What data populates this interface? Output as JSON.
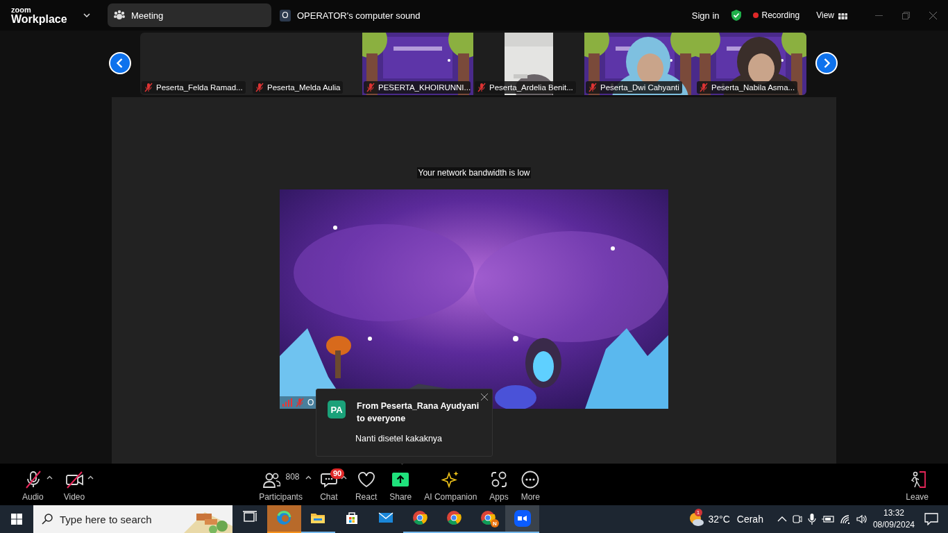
{
  "title_bar": {
    "logo_top": "zoom",
    "logo": "Workplace",
    "meeting_tab": {
      "label": "Meeting",
      "selected": true
    },
    "audio_source": {
      "badge": "O",
      "label": "OPERATOR's computer sound"
    },
    "sign_in": "Sign in",
    "recording": "Recording",
    "view": "View"
  },
  "gallery": {
    "tiles": [
      {
        "kind": "blank",
        "name": "Peserta_Felda Ramad...",
        "muted": true
      },
      {
        "kind": "blank",
        "name": "Peserta_Melda Aulia",
        "muted": true
      },
      {
        "kind": "picture",
        "name": "PESERTA_KHOIRUNNI...",
        "muted": true
      },
      {
        "kind": "picture",
        "name": "Peserta_Ardelia Benit...",
        "muted": true
      },
      {
        "kind": "picture",
        "name": "Peserta_Dwi Cahyanti",
        "muted": true
      },
      {
        "kind": "picture",
        "name": "Peserta_Nabila Asma...",
        "muted": true
      }
    ]
  },
  "stage": {
    "notice": "Your network bandwidth is low",
    "speaker": {
      "name": "O",
      "muted": true
    }
  },
  "chat_popup": {
    "avatar": "PA",
    "sender": "From Peserta_Rana Ayudyani to everyone",
    "message": "Nanti disetel kakaknya"
  },
  "toolbar": {
    "left": [
      {
        "kind": "audio",
        "label": "Audio",
        "off": true,
        "menu": true
      },
      {
        "kind": "video",
        "label": "Video",
        "off": true,
        "menu": true
      }
    ],
    "center": [
      {
        "kind": "participants",
        "label": "Participants",
        "count": "808",
        "menu": true
      },
      {
        "kind": "chat",
        "label": "Chat",
        "badge": "90",
        "menu": true
      },
      {
        "kind": "react",
        "label": "React",
        "menu": false
      },
      {
        "kind": "share",
        "label": "Share",
        "menu": false
      },
      {
        "kind": "ai",
        "label": "AI Companion",
        "menu": false
      },
      {
        "kind": "apps",
        "label": "Apps",
        "menu": false
      },
      {
        "kind": "more",
        "label": "More",
        "menu": false
      }
    ],
    "right": [
      {
        "kind": "leave",
        "label": "Leave",
        "menu": false
      }
    ]
  },
  "taskbar": {
    "search": {
      "placeholder": "Type here to search"
    },
    "apps": [
      {
        "kind": "task-view",
        "running": false,
        "flashing": false,
        "selected": false
      },
      {
        "kind": "edge",
        "running": false,
        "flashing": true,
        "selected": false
      },
      {
        "kind": "explorer",
        "running": true,
        "flashing": false,
        "selected": false
      },
      {
        "kind": "store",
        "running": false,
        "flashing": false,
        "selected": false
      },
      {
        "kind": "mail",
        "running": false,
        "flashing": false,
        "selected": false
      },
      {
        "kind": "chrome",
        "running": true,
        "flashing": false,
        "selected": false
      },
      {
        "kind": "chrome",
        "running": true,
        "flashing": false,
        "selected": false
      },
      {
        "kind": "chrome",
        "running": true,
        "flashing": false,
        "selected": false,
        "badge": "N"
      },
      {
        "kind": "zoom",
        "running": true,
        "flashing": false,
        "selected": true
      }
    ],
    "weather": {
      "badge": "1",
      "temperature": "32°C",
      "condition": "Cerah"
    },
    "time": "13:32",
    "date": "08/09/2024"
  }
}
